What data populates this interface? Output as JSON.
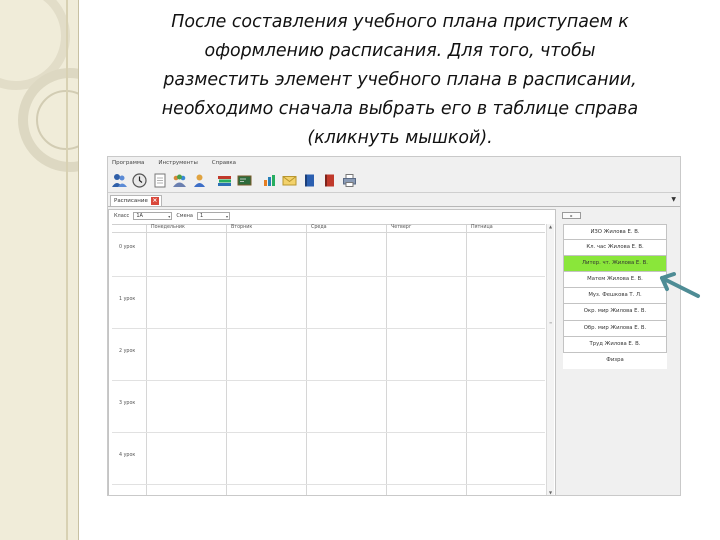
{
  "slide": {
    "caption_lines": [
      "После составления учебного плана приступаем к",
      "оформлению расписания. Для того, чтобы",
      "разместить элемент учебного плана в расписании,",
      "необходимо сначала выбрать его в таблице справа",
      "(кликнуть мышкой)."
    ]
  },
  "app": {
    "menu": [
      "Программа",
      "Инструменты",
      "Справка"
    ],
    "toolbar_icons": [
      "users-icon",
      "clock-icon",
      "document-icon",
      "group-icon",
      "person-icon",
      "books-icon",
      "chalkboard-icon",
      "chart-icon",
      "envelope-icon",
      "blue-book-icon",
      "red-book-icon",
      "printer-icon"
    ],
    "tab": {
      "label": "Расписание",
      "close": "×"
    },
    "dropdown_arrow": "▼",
    "filters": {
      "class_label": "Класс",
      "class_value": "1А",
      "shift_label": "Смена",
      "shift_value": "1",
      "arrow": "▾"
    },
    "days": [
      "Понедельник",
      "Вторник",
      "Среда",
      "Четверг",
      "Пятница"
    ],
    "lessons": [
      "0 урок",
      "1 урок",
      "2 урок",
      "3 урок",
      "4 урок"
    ],
    "scroll": {
      "up": "▲",
      "down": "▼",
      "mark": "≡"
    },
    "right_button": "▸",
    "plan_items": [
      "ИЗО Жилова Е. В.",
      "Кл. час Жилова Е. В.",
      "Литер. чт. Жилова Е. В.",
      "Матем Жилова Е. В.",
      "Муз. Фешкова Т. Л.",
      "Окр. мир Жилова Е. В.",
      "Обр. мир Жилова Е. В.",
      "Труд Жилова Е. В.",
      "Физра"
    ],
    "selected_index": 2,
    "colors": {
      "selected": "#8ae63a",
      "close": "#d9483b",
      "arrow": "#4e8c95"
    }
  }
}
